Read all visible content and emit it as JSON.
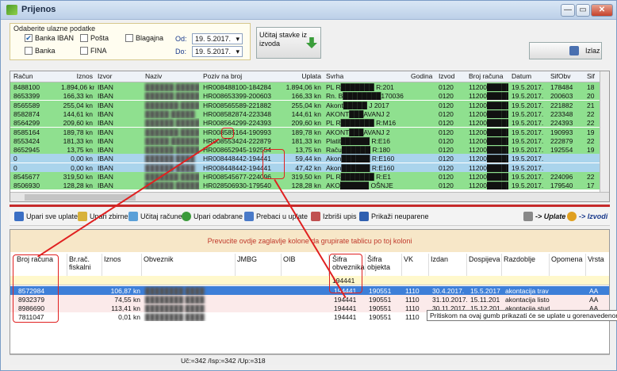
{
  "window": {
    "title": "Prijenos",
    "min": "—",
    "max": "▭",
    "close": "✕"
  },
  "filters": {
    "title": "Odaberite ulazne podatke",
    "banka_iban": "Banka IBAN",
    "posta": "Pošta",
    "blagajna": "Blagajna",
    "banka": "Banka",
    "fina": "FINA",
    "od_label": "Od:",
    "do_label": "Do:",
    "od_value": "19. 5.2017.",
    "do_value": "19. 5.2017.",
    "banka_iban_checked": true
  },
  "buttons": {
    "load": "Učitaj stavke iz izvoda",
    "exit": "Izlaz"
  },
  "top_grid": {
    "headers": [
      "Račun",
      "Iznos",
      "Izvor",
      "Naziv",
      "Poziv na broj",
      "Uplata",
      "Svrha",
      "Godina",
      "Izvod",
      "Broj računa",
      "Datum",
      "SifObv",
      "Sif"
    ],
    "rows": [
      {
        "racun": "8488100",
        "iznos": "1.894,06 kn",
        "izvor": "IBAN",
        "naziv": "██████ ██████",
        "poziv": "HR008488100-184284",
        "uplata": "1.894,06 kn",
        "svrha": "PL R███████ R:201",
        "izvod": "0120",
        "broj": "11200█████",
        "datum": "19.5.2017.",
        "sif": "178484",
        "sif2": "18",
        "color": "green"
      },
      {
        "racun": "8653399",
        "iznos": "166,33 kn",
        "izvor": "IBAN",
        "naziv": "██████ █████",
        "poziv": "HR008653399-200603",
        "uplata": "166,33 kn",
        "svrha": "Rn. B████████1700368",
        "izvod": "0120",
        "broj": "11200█████",
        "datum": "19.5.2017.",
        "sif": "200603",
        "sif2": "20",
        "color": "green"
      },
      {
        "racun": "8565589",
        "iznos": "255,04 kn",
        "izvor": "IBAN",
        "naziv": "███████ ████",
        "poziv": "HR008565589-221882",
        "uplata": "255,04 kn",
        "svrha": "Akont█████ J 2017",
        "izvod": "0120",
        "broj": "11200█████",
        "datum": "19.5.2017.",
        "sif": "221882",
        "sif2": "21",
        "color": "green"
      },
      {
        "racun": "8582874",
        "iznos": "144,61 kn",
        "izvor": "IBAN",
        "naziv": "█████ █████",
        "poziv": "HR008582874-223348",
        "uplata": "144,61 kn",
        "svrha": "AKONT███AVANJ 2",
        "izvod": "0120",
        "broj": "11200█████",
        "datum": "19.5.2017.",
        "sif": "223348",
        "sif2": "22",
        "color": "green"
      },
      {
        "racun": "8564299",
        "iznos": "209,60 kn",
        "izvor": "IBAN",
        "naziv": "██████ ██████",
        "poziv": "HR008564299-224393",
        "uplata": "209,60 kn",
        "svrha": "PL R███████ R:M16",
        "izvod": "0120",
        "broj": "11200█████",
        "datum": "19.5.2017.",
        "sif": "224393",
        "sif2": "22",
        "color": "green"
      },
      {
        "racun": "8585164",
        "iznos": "189,78 kn",
        "izvor": "IBAN",
        "naziv": "███████ ████",
        "poziv": "HR008585164-190993",
        "uplata": "189,78 kn",
        "svrha": "AKONT███AVANJ 2",
        "izvod": "0120",
        "broj": "11200█████",
        "datum": "19.5.2017.",
        "sif": "190993",
        "sif2": "19",
        "color": "green"
      },
      {
        "racun": "8553424",
        "iznos": "181,33 kn",
        "izvor": "IBAN",
        "naziv": "█████ ██████",
        "poziv": "HR008553424-222879",
        "uplata": "181,33 kn",
        "svrha": "Platit██████ R:E16",
        "izvod": "0120",
        "broj": "11200█████",
        "datum": "19.5.2017.",
        "sif": "222879",
        "sif2": "22",
        "color": "green"
      },
      {
        "racun": "8652945",
        "iznos": "13,75 kn",
        "izvor": "IBAN",
        "naziv": "██████ █████",
        "poziv": "HR008652945-192554",
        "uplata": "13,75 kn",
        "svrha": "Raču██████ R:180",
        "izvod": "0120",
        "broj": "11200█████",
        "datum": "19.5.2017.",
        "sif": "192554",
        "sif2": "19",
        "color": "green"
      },
      {
        "racun": "0",
        "iznos": "0,00 kn",
        "izvor": "IBAN",
        "naziv": "██████ ████",
        "poziv": "HR008448442-194441",
        "uplata": "59,44 kn",
        "svrha": "Akon██████ R:E160",
        "izvod": "0120",
        "broj": "11200█████",
        "datum": "19.5.2017.",
        "sif": "",
        "sif2": "",
        "color": "blue"
      },
      {
        "racun": "0",
        "iznos": "0,00 kn",
        "izvor": "IBAN",
        "naziv": "██████ ████",
        "poziv": "HR008448442-194441",
        "uplata": "47,42 kn",
        "svrha": "Akon██████ R:E160",
        "izvod": "0120",
        "broj": "11200█████",
        "datum": "19.5.2017.",
        "sif": "",
        "sif2": "",
        "color": "blue"
      },
      {
        "racun": "8545677",
        "iznos": "319,50 kn",
        "izvor": "IBAN",
        "naziv": "███████ █████",
        "poziv": "HR008545677-224096",
        "uplata": "319,50 kn",
        "svrha": "PL R███████ R:E1",
        "izvod": "0120",
        "broj": "11200█████",
        "datum": "19.5.2017.",
        "sif": "224096",
        "sif2": "22",
        "color": "green"
      },
      {
        "racun": "8506930",
        "iznos": "128,28 kn",
        "izvor": "IBAN",
        "naziv": "██████ ██████",
        "poziv": "HR028506930-179540",
        "uplata": "128,28 kn",
        "svrha": "AKO██████ OŠNJE",
        "izvod": "0120",
        "broj": "11200█████",
        "datum": "19.5.2017.",
        "sif": "179540",
        "sif2": "17",
        "color": "green"
      }
    ]
  },
  "toolbar": {
    "upari_sve": "Upari sve uplate",
    "upari_zbirne": "Upari zbirne",
    "ucitaj_racune": "Učitaj račune",
    "upari_odabrane": "Upari odabrane",
    "prebaci": "Prebaci u uplate",
    "izbrisi": "Izbriši upis",
    "prikazi": "Prikaži neuparene",
    "uplate": "-> Uplate",
    "izvodi": "-> Izvodi"
  },
  "bottom_grid": {
    "group_hint": "Prevucite ovdje zaglavlje kolone da grupirate tablicu po toj koloni",
    "headers": [
      "Broj računa",
      "Br.rač. fiskalni",
      "Iznos",
      "Obveznik",
      "JMBG",
      "OIB",
      "Šifra obveznika",
      "Šifra objekta",
      "VK",
      "Izdan",
      "Dospijeva",
      "Razdoblje",
      "Opomena",
      "Vrsta"
    ],
    "filter_sifra": "194441",
    "rows": [
      {
        "broj": "8572984",
        "iznos": "106,87 kn",
        "sifra": "194441",
        "objekt": "190551",
        "vk": "1110",
        "izdan": "30.4.2017.",
        "dosp": "15.5.2017",
        "razd": "akontacija trav",
        "vrsta": "AA",
        "style": "sel"
      },
      {
        "broj": "8932379",
        "iznos": "74,55 kn",
        "sifra": "194441",
        "objekt": "190551",
        "vk": "1110",
        "izdan": "31.10.2017.",
        "dosp": "15.11.201",
        "razd": "akontacija listo",
        "vrsta": "AA",
        "style": "alt"
      },
      {
        "broj": "8986690",
        "iznos": "113,41 kn",
        "sifra": "194441",
        "objekt": "190551",
        "vk": "1110",
        "izdan": "30.11.2017.",
        "dosp": "15.12.201",
        "razd": "akontacija stud",
        "vrsta": "AA",
        "style": "alt"
      },
      {
        "broj": "7811047",
        "iznos": "0,01 kn",
        "sifra": "194441",
        "objekt": "190551",
        "vk": "1110",
        "izdan": "",
        "dosp": "",
        "razd": "",
        "vrsta": "AA",
        "style": "plain"
      }
    ],
    "tooltip": "Pritiskom na ovaj gumb prikazati će se uplate u gorenavedenom"
  },
  "status": {
    "text": "Uč:=342 /Isp:=342 /Up:=318"
  },
  "colors": {
    "green_row": "#8fe08f",
    "blue_row": "#aad4ec",
    "selected": "#3d7fd8",
    "highlight": "#e02020"
  }
}
